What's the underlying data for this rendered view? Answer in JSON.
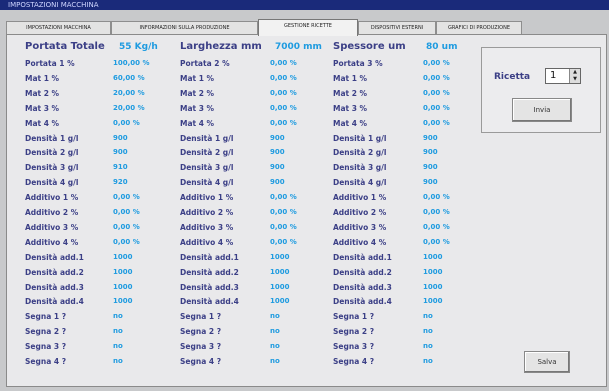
{
  "window": {
    "title": "IMPOSTAZIONI MACCHINA"
  },
  "tabs": [
    {
      "label": "IMPOSTAZIONI MACCHINA"
    },
    {
      "label": "INFORMAZIONI SULLA PRODUZIONE"
    },
    {
      "label": "GESTIONE RICETTE"
    },
    {
      "label": "DISPOSITIVI ESTERNI"
    },
    {
      "label": "GRAFICI DI PRODUZIONE"
    }
  ],
  "columns": [
    {
      "header": "Portata Totale",
      "header_value": "55 Kg/h",
      "rows": [
        {
          "label": "Portata 1 %",
          "value": "100,00 %"
        },
        {
          "label": "Mat 1 %",
          "value": "60,00 %"
        },
        {
          "label": "Mat 2 %",
          "value": "20,00 %"
        },
        {
          "label": "Mat 3 %",
          "value": "20,00 %"
        },
        {
          "label": "Mat 4 %",
          "value": "0,00 %"
        },
        {
          "label": "Densità 1 g/l",
          "value": "900"
        },
        {
          "label": "Densità 2 g/l",
          "value": "900"
        },
        {
          "label": "Densità 3 g/l",
          "value": "910"
        },
        {
          "label": "Densità 4 g/l",
          "value": "920"
        },
        {
          "label": "Additivo 1 %",
          "value": "0,00 %"
        },
        {
          "label": "Additivo 2 %",
          "value": "0,00 %"
        },
        {
          "label": "Additivo 3 %",
          "value": "0,00 %"
        },
        {
          "label": "Additivo 4 %",
          "value": "0,00 %"
        },
        {
          "label": "Densità add.1",
          "value": "1000"
        },
        {
          "label": "Densità add.2",
          "value": "1000"
        },
        {
          "label": "Densità add.3",
          "value": "1000"
        },
        {
          "label": "Densità add.4",
          "value": "1000"
        },
        {
          "label": "Segna 1 ?",
          "value": "no"
        },
        {
          "label": "Segna 2 ?",
          "value": "no"
        },
        {
          "label": "Segna 3 ?",
          "value": "no"
        },
        {
          "label": "Segna 4 ?",
          "value": "no"
        }
      ]
    },
    {
      "header": "Larghezza mm",
      "header_value": "7000 mm",
      "rows": [
        {
          "label": "Portata 2 %",
          "value": "0,00 %"
        },
        {
          "label": "Mat 1 %",
          "value": "0,00 %"
        },
        {
          "label": "Mat 2 %",
          "value": "0,00 %"
        },
        {
          "label": "Mat 3 %",
          "value": "0,00 %"
        },
        {
          "label": "Mat 4 %",
          "value": "0,00 %"
        },
        {
          "label": "Densità 1 g/l",
          "value": "900"
        },
        {
          "label": "Densità 2 g/l",
          "value": "900"
        },
        {
          "label": "Densità 3 g/l",
          "value": "900"
        },
        {
          "label": "Densità 4 g/l",
          "value": "900"
        },
        {
          "label": "Additivo 1 %",
          "value": "0,00 %"
        },
        {
          "label": "Additivo 2 %",
          "value": "0,00 %"
        },
        {
          "label": "Additivo 3 %",
          "value": "0,00 %"
        },
        {
          "label": "Additivo 4 %",
          "value": "0,00 %"
        },
        {
          "label": "Densità add.1",
          "value": "1000"
        },
        {
          "label": "Densità add.2",
          "value": "1000"
        },
        {
          "label": "Densità add.3",
          "value": "1000"
        },
        {
          "label": "Densità add.4",
          "value": "1000"
        },
        {
          "label": "Segna 1 ?",
          "value": "no"
        },
        {
          "label": "Segna 2 ?",
          "value": "no"
        },
        {
          "label": "Segna 3 ?",
          "value": "no"
        },
        {
          "label": "Segna 4 ?",
          "value": "no"
        }
      ]
    },
    {
      "header": "Spessore um",
      "header_value": "80 um",
      "rows": [
        {
          "label": "Portata 3 %",
          "value": "0,00 %"
        },
        {
          "label": "Mat 1 %",
          "value": "0,00 %"
        },
        {
          "label": "Mat 2 %",
          "value": "0,00 %"
        },
        {
          "label": "Mat 3 %",
          "value": "0,00 %"
        },
        {
          "label": "Mat 4 %",
          "value": "0,00 %"
        },
        {
          "label": "Densità 1 g/l",
          "value": "900"
        },
        {
          "label": "Densità 2 g/l",
          "value": "900"
        },
        {
          "label": "Densità 3 g/l",
          "value": "900"
        },
        {
          "label": "Densità 4 g/l",
          "value": "900"
        },
        {
          "label": "Additivo 1 %",
          "value": "0,00 %"
        },
        {
          "label": "Additivo 2 %",
          "value": "0,00 %"
        },
        {
          "label": "Additivo 3 %",
          "value": "0,00 %"
        },
        {
          "label": "Additivo 4 %",
          "value": "0,00 %"
        },
        {
          "label": "Densità add.1",
          "value": "1000"
        },
        {
          "label": "Densità add.2",
          "value": "1000"
        },
        {
          "label": "Densità add.3",
          "value": "1000"
        },
        {
          "label": "Densità add.4",
          "value": "1000"
        },
        {
          "label": "Segna 1 ?",
          "value": "no"
        },
        {
          "label": "Segna 2 ?",
          "value": "no"
        },
        {
          "label": "Segna 3 ?",
          "value": "no"
        },
        {
          "label": "Segna 4 ?",
          "value": "no"
        }
      ]
    }
  ],
  "recipe": {
    "label": "Ricetta",
    "value": "1",
    "up_glyph": "▲",
    "down_glyph": "▼"
  },
  "buttons": {
    "invia": "Invia",
    "salva": "Salva"
  }
}
